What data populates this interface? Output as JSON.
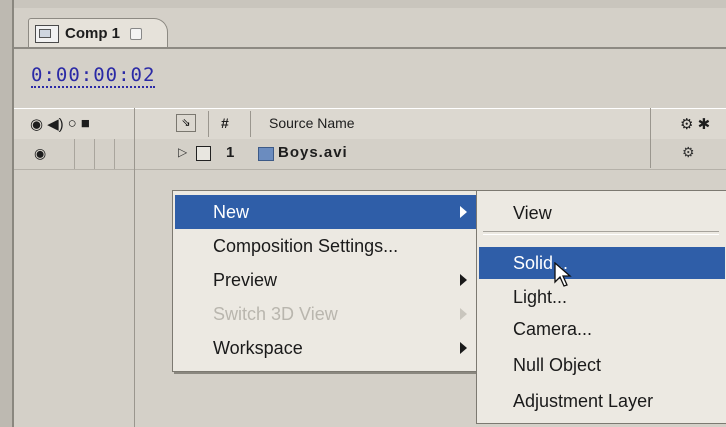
{
  "tab": {
    "label": "Comp 1"
  },
  "timecode": "0:00:00:02",
  "header": {
    "hash": "#",
    "source_name": "Source Name"
  },
  "layer": {
    "number": "1",
    "name": "Boys.avi"
  },
  "context_menu": {
    "items": [
      {
        "label": "New",
        "submenu": true,
        "highlighted": true,
        "disabled": false
      },
      {
        "label": "Composition Settings...",
        "submenu": false,
        "highlighted": false,
        "disabled": false
      },
      {
        "label": "Preview",
        "submenu": true,
        "highlighted": false,
        "disabled": false
      },
      {
        "label": "Switch 3D View",
        "submenu": true,
        "highlighted": false,
        "disabled": true
      },
      {
        "label": "Workspace",
        "submenu": true,
        "highlighted": false,
        "disabled": false
      }
    ]
  },
  "submenu": {
    "items": [
      {
        "label": "View",
        "highlighted": false
      },
      {
        "label": "Solid...",
        "highlighted": true
      },
      {
        "label": "Light...",
        "highlighted": false
      },
      {
        "label": "Camera...",
        "highlighted": false
      },
      {
        "label": "Null Object",
        "highlighted": false
      },
      {
        "label": "Adjustment Layer",
        "highlighted": false
      }
    ]
  },
  "colors": {
    "highlight": "#2f5ea8",
    "timecode": "#2b2aa6",
    "panel": "#d4d0c8"
  }
}
